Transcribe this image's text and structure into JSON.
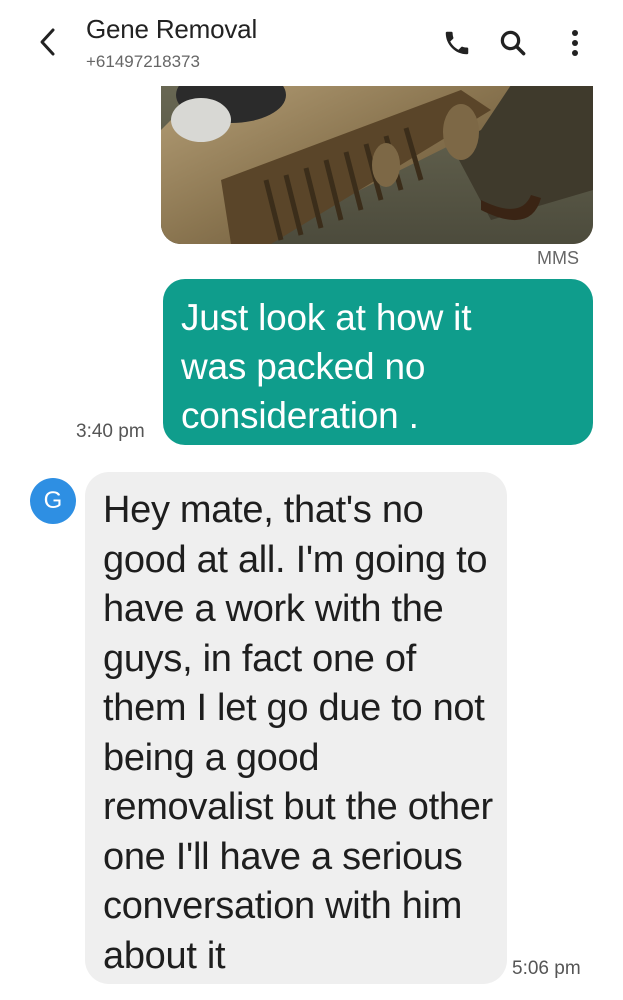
{
  "header": {
    "contact_name": "Gene Removal",
    "phone_number": "+61497218373",
    "icons": {
      "back": "chevron-left-icon",
      "call": "phone-icon",
      "search": "search-icon",
      "more": "more-vert-icon"
    }
  },
  "messages": [
    {
      "type": "mms",
      "direction": "outgoing",
      "label": "MMS",
      "image": "photo of carved wooden furniture"
    },
    {
      "type": "text",
      "direction": "outgoing",
      "text": "Just look at how it was packed no consideration .",
      "time": "3:40 pm"
    },
    {
      "type": "text",
      "direction": "incoming",
      "avatar_initial": "G",
      "text": "Hey mate, that's no good at all. I'm going to have a work with the guys, in fact one of them I let go due to not being a good removalist but the other one I'll have a serious conversation with him about it",
      "time": "5:06 pm"
    }
  ],
  "colors": {
    "sent_bubble": "#0f9d8c",
    "received_bubble": "#efefef",
    "avatar": "#2e8fe3"
  }
}
